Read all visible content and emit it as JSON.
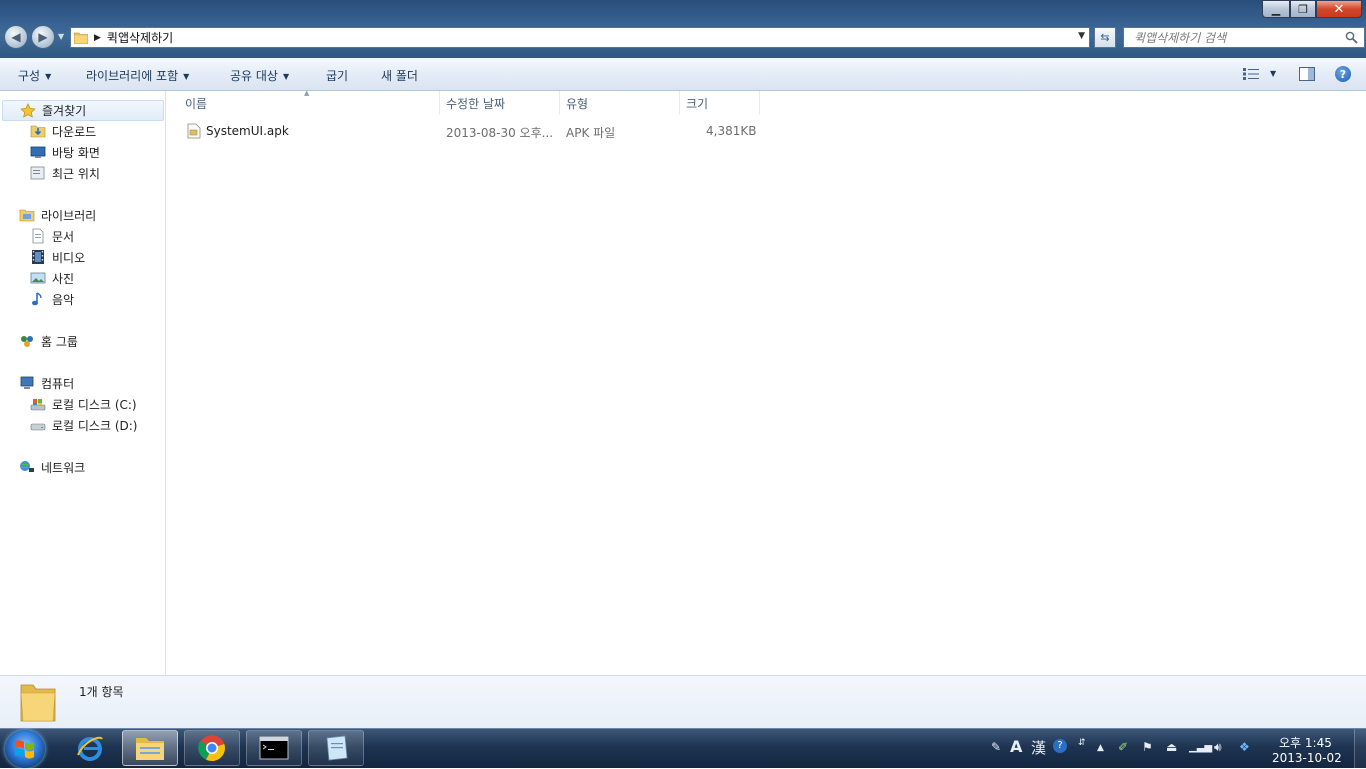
{
  "window": {
    "address_path": "퀵앱삭제하기",
    "search_placeholder": "퀵앱삭제하기 검색",
    "minimize_glyph": "▁",
    "maximize_glyph": "❐",
    "close_glyph": "✕"
  },
  "toolbar": {
    "organize": "구성",
    "include_in_library": "라이브러리에 포함",
    "share_with": "공유 대상",
    "burn": "굽기",
    "new_folder": "새 폴더"
  },
  "sidebar": {
    "favorites": {
      "label": "즐겨찾기",
      "items": [
        {
          "label": "다운로드",
          "icon": "download-folder-icon"
        },
        {
          "label": "바탕 화면",
          "icon": "desktop-icon"
        },
        {
          "label": "최근 위치",
          "icon": "recent-places-icon"
        }
      ]
    },
    "libraries": {
      "label": "라이브러리",
      "items": [
        {
          "label": "문서",
          "icon": "documents-icon"
        },
        {
          "label": "비디오",
          "icon": "videos-icon"
        },
        {
          "label": "사진",
          "icon": "pictures-icon"
        },
        {
          "label": "음악",
          "icon": "music-icon"
        }
      ]
    },
    "homegroup": {
      "label": "홈 그룹"
    },
    "computer": {
      "label": "컴퓨터",
      "items": [
        {
          "label": "로컬 디스크 (C:)",
          "icon": "drive-c-icon"
        },
        {
          "label": "로컬 디스크 (D:)",
          "icon": "drive-d-icon"
        }
      ]
    },
    "network": {
      "label": "네트워크"
    }
  },
  "filelist": {
    "columns": [
      "이름",
      "수정한 날짜",
      "유형",
      "크기"
    ],
    "rows": [
      {
        "name": "SystemUI.apk",
        "modified": "2013-08-30 오후...",
        "type": "APK 파일",
        "size": "4,381KB"
      }
    ]
  },
  "details": {
    "item_count": "1개 항목"
  },
  "taskbar": {
    "clock_time": "오후 1:45",
    "clock_date": "2013-10-02",
    "ime_mode": "A",
    "hanja": "漢"
  },
  "colors": {
    "title_bar": "#365f8f",
    "command_text": "#1e395b",
    "taskbar": "#1e3452",
    "close_button": "#d3462b"
  }
}
